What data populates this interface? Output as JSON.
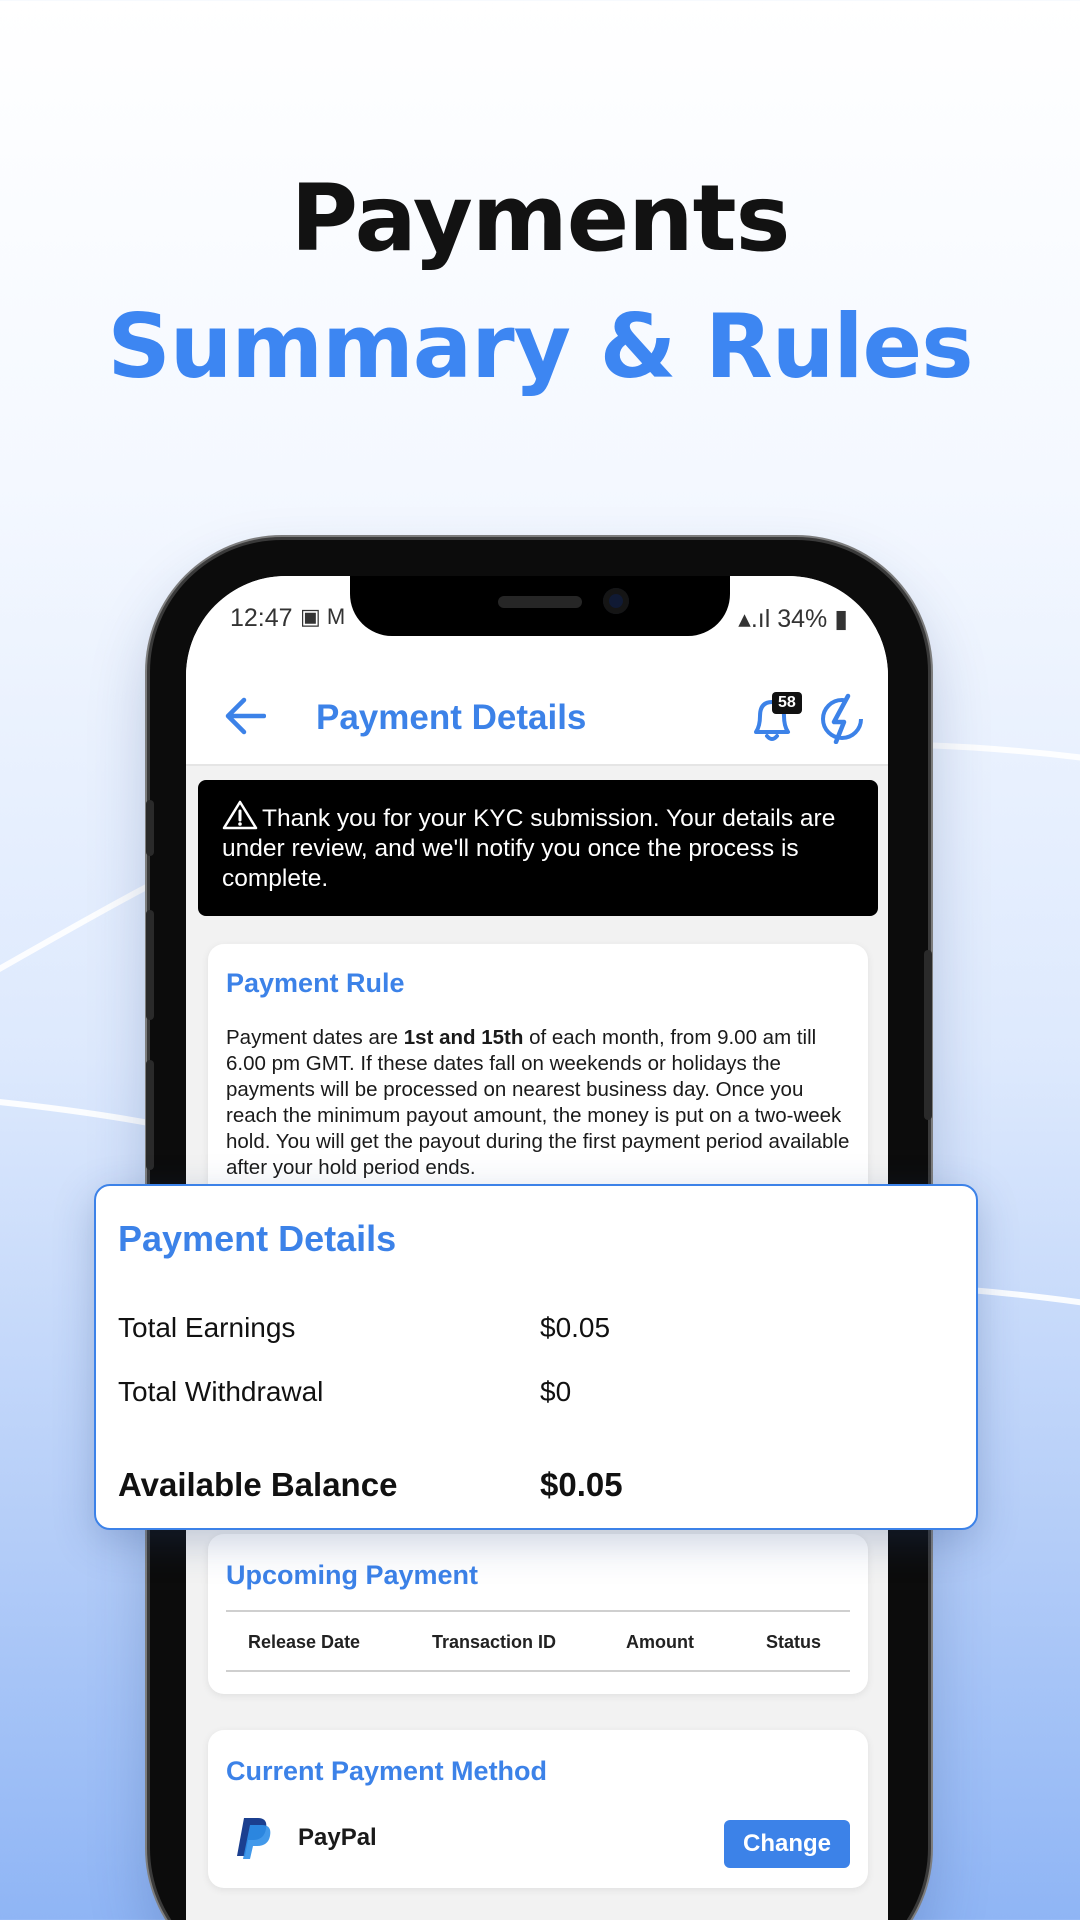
{
  "headline": {
    "line1": "Payments",
    "line2": "Summary & Rules"
  },
  "status_bar": {
    "time": "12:47",
    "battery": "34%"
  },
  "app_bar": {
    "title": "Payment Details",
    "notification_count": "58"
  },
  "kyc_banner": {
    "text": "Thank you for your KYC submission. Your details are under review, and we'll notify you once the process is complete."
  },
  "payment_rule": {
    "title": "Payment Rule",
    "text_before": "Payment dates are ",
    "text_bold": "1st and 15th",
    "text_after": "  of each month, from 9.00 am till 6.00 pm GMT. If these dates fall on weekends or holidays the payments will be processed on nearest business day. Once you reach the minimum payout amount, the money is put on a two-week hold. You will get the payout during the first payment period available after your hold period ends."
  },
  "payment_details": {
    "title": "Payment Details",
    "rows": [
      {
        "label": "Total Earnings",
        "value": "$0.05"
      },
      {
        "label": "Total Withdrawal",
        "value": "$0"
      }
    ],
    "balance_label": "Available Balance",
    "balance_value": "$0.05"
  },
  "upcoming_payment": {
    "title": "Upcoming Payment",
    "columns": [
      "Release Date",
      "Transaction ID",
      "Amount",
      "Status"
    ]
  },
  "payment_method": {
    "title": "Current Payment Method",
    "method_name": "PayPal",
    "change_label": "Change"
  },
  "colors": {
    "accent": "#3c82e8",
    "headline_dark": "#121212",
    "banner_bg": "#000000"
  },
  "icons": [
    "back-arrow-icon",
    "bell-icon",
    "bolt-icon",
    "warning-icon",
    "paypal-logo"
  ]
}
